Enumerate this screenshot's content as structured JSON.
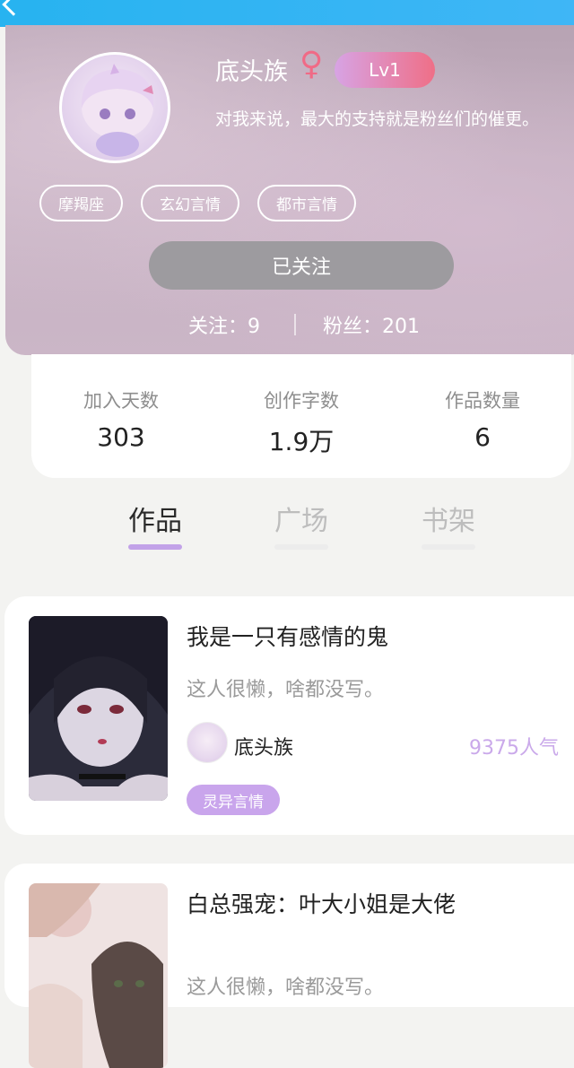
{
  "profile": {
    "username": "底头族",
    "gender_icon": "♀",
    "level": "Lv1",
    "bio": "对我来说，最大的支持就是粉丝们的催更。",
    "tags": [
      "摩羯座",
      "玄幻言情",
      "都市言情"
    ],
    "follow_button": "已关注",
    "following": "关注：9",
    "followers": "粉丝：201"
  },
  "stats": [
    {
      "label": "加入天数",
      "value": "303"
    },
    {
      "label": "创作字数",
      "value": "1.9万"
    },
    {
      "label": "作品数量",
      "value": "6"
    }
  ],
  "tabs": [
    {
      "label": "作品",
      "active": true
    },
    {
      "label": "广场",
      "active": false
    },
    {
      "label": "书架",
      "active": false
    }
  ],
  "books": [
    {
      "title": "我是一只有感情的鬼",
      "desc": "这人很懒，啥都没写。",
      "author": "底头族",
      "popularity": "9375人气",
      "genre": "灵异言情"
    },
    {
      "title": "白总强宠：叶大小姐是大佬",
      "desc": "这人很懒，啥都没写。"
    }
  ],
  "colors": {
    "accent": "#c2a2e8",
    "topbar": "#27b3f0",
    "gender": "#f06a86"
  }
}
